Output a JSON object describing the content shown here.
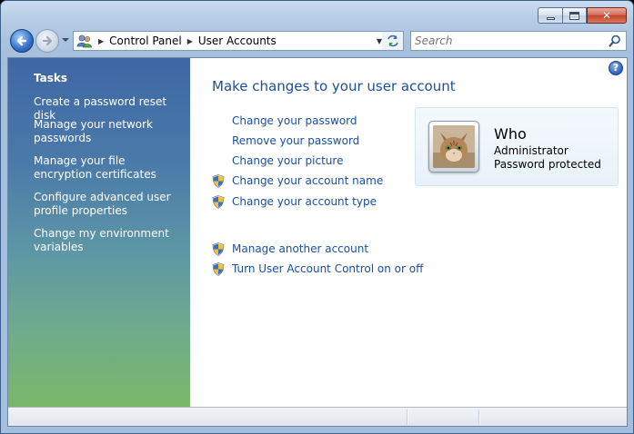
{
  "address": {
    "crumbs": [
      "Control Panel",
      "User Accounts"
    ]
  },
  "search": {
    "placeholder": "Search"
  },
  "sidebar": {
    "title": "Tasks",
    "items": [
      {
        "label": "Create a password reset disk"
      },
      {
        "label": "Manage your network passwords"
      },
      {
        "label": "Manage your file encryption certificates"
      },
      {
        "label": "Configure advanced user profile properties"
      },
      {
        "label": "Change my environment variables"
      }
    ]
  },
  "main": {
    "title": "Make changes to your user account",
    "actions": [
      {
        "label": "Change your password",
        "shield": false
      },
      {
        "label": "Remove your password",
        "shield": false
      },
      {
        "label": "Change your picture",
        "shield": false
      },
      {
        "label": "Change your account name",
        "shield": true
      },
      {
        "label": "Change your account type",
        "shield": true
      }
    ],
    "other_actions": [
      {
        "label": "Manage another account",
        "shield": true
      },
      {
        "label": "Turn User Account Control on or off",
        "shield": true
      }
    ]
  },
  "account": {
    "name": "Who",
    "type": "Administrator",
    "status": "Password protected"
  },
  "help": {
    "glyph": "?"
  },
  "colors": {
    "link": "#1a4fa3",
    "title": "#1e4e9a",
    "sidebar_top": "#3e67a5",
    "sidebar_bottom": "#79b86a"
  }
}
